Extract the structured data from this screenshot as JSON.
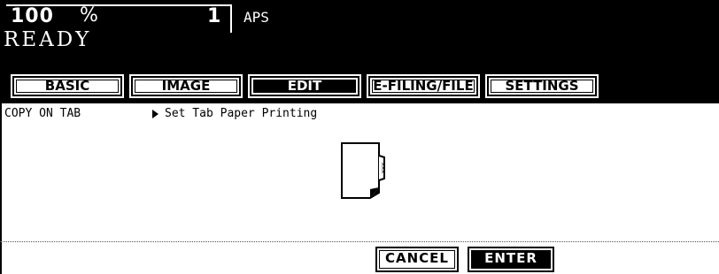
{
  "status_bar": {
    "zoom": "100",
    "zoom_unit": "%",
    "copies": "1",
    "paper_mode": "APS",
    "status": "READY"
  },
  "tabs": [
    {
      "label": "BASIC",
      "active": false
    },
    {
      "label": "IMAGE",
      "active": false
    },
    {
      "label": "EDIT",
      "active": true
    },
    {
      "label": "E-FILING/FILE",
      "active": false
    },
    {
      "label": "SETTINGS",
      "active": false
    }
  ],
  "function": {
    "name": "COPY ON TAB",
    "description": "Set Tab Paper Printing",
    "icon": "tab-paper-icon",
    "tab_text": "xxx"
  },
  "buttons": {
    "cancel": "CANCEL",
    "enter": "ENTER"
  }
}
